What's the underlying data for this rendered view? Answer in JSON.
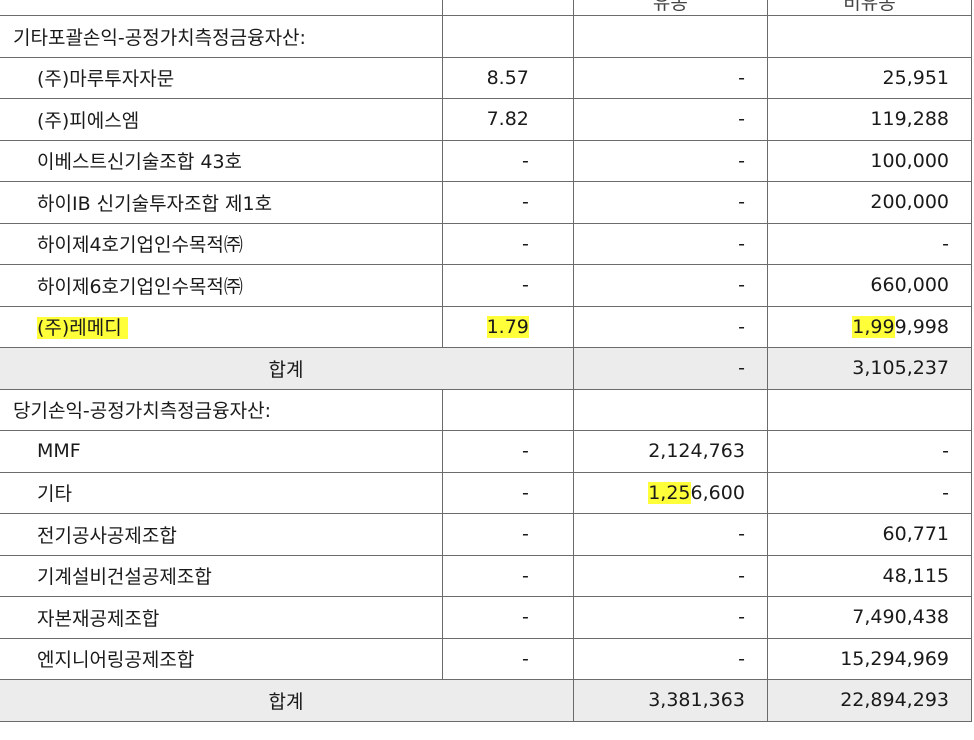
{
  "header": {
    "col_current": "유동",
    "col_noncurrent": "비유동"
  },
  "sections": [
    {
      "title": "기타포괄손익-공정가치측정금융자산:",
      "rows": [
        {
          "name": "(주)마루투자자문",
          "ratio": "8.57",
          "current": "-",
          "noncurrent": "25,951"
        },
        {
          "name": "(주)피에스엠",
          "ratio": "7.82",
          "current": "-",
          "noncurrent": "119,288"
        },
        {
          "name": "이베스트신기술조합 43호",
          "ratio": "-",
          "current": "-",
          "noncurrent": "100,000"
        },
        {
          "name": "하이IB 신기술투자조합 제1호",
          "ratio": "-",
          "current": "-",
          "noncurrent": "200,000"
        },
        {
          "name": "하이제4호기업인수목적㈜",
          "ratio": "-",
          "current": "-",
          "noncurrent": "-"
        },
        {
          "name": "하이제6호기업인수목적㈜",
          "ratio": "-",
          "current": "-",
          "noncurrent": "660,000"
        },
        {
          "name": "(주)레메디",
          "ratio": "1.79",
          "current": "-",
          "noncurrent": "1,999,998"
        }
      ],
      "total": {
        "label": "합계",
        "current": "-",
        "noncurrent": "3,105,237"
      }
    },
    {
      "title": "당기손익-공정가치측정금융자산:",
      "rows": [
        {
          "name": "MMF",
          "ratio": "-",
          "current": "2,124,763",
          "noncurrent": "-"
        },
        {
          "name": "기타",
          "ratio": "-",
          "current": "1,256,600",
          "noncurrent": "-"
        },
        {
          "name": "전기공사공제조합",
          "ratio": "-",
          "current": "-",
          "noncurrent": "60,771"
        },
        {
          "name": "기계설비건설공제조합",
          "ratio": "-",
          "current": "-",
          "noncurrent": "48,115"
        },
        {
          "name": "자본재공제조합",
          "ratio": "-",
          "current": "-",
          "noncurrent": "7,490,438"
        },
        {
          "name": "엔지니어링공제조합",
          "ratio": "-",
          "current": "-",
          "noncurrent": "15,294,969"
        }
      ],
      "total": {
        "label": "합계",
        "current": "3,381,363",
        "noncurrent": "22,894,293"
      }
    }
  ],
  "highlight_color": "#ffff3a"
}
